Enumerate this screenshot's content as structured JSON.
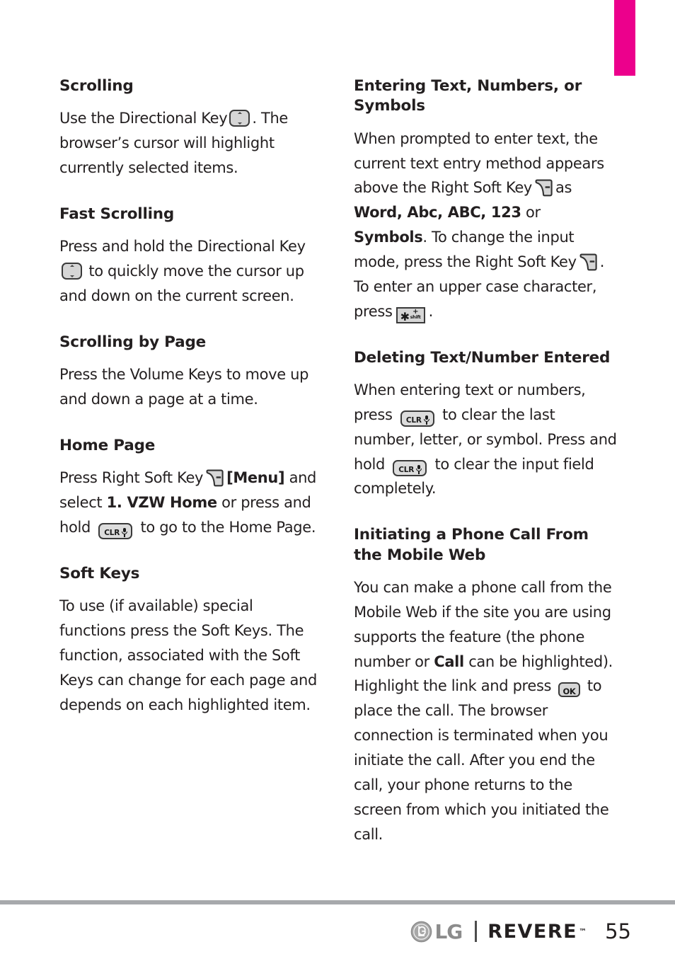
{
  "page": {
    "number": "55",
    "accent_color": "#ec008c",
    "rule_color": "#a7a9ac",
    "text_color": "#231f20"
  },
  "left_column": {
    "sections": [
      {
        "heading": "Scrolling",
        "paragraph": {
          "part1": "Use the Directional Key",
          "icon": "directional-key-icon",
          "part2": ". The browser’s cursor will highlight currently selected items."
        }
      },
      {
        "heading": "Fast Scrolling",
        "paragraph": {
          "part1": "Press and hold the Directional Key",
          "icon": "directional-key-icon",
          "part2": "to quickly move the cursor up and down on the current screen."
        }
      },
      {
        "heading": "Scrolling by Page",
        "paragraph": {
          "part1": "Press the Volume Keys to move up and down a page at a time."
        }
      },
      {
        "heading": "Home Page",
        "paragraph": {
          "part1": "Press Right Soft Key",
          "icon1": "right-soft-key-icon",
          "part2": "[Menu]",
          "part3": "and select",
          "part4": "1. VZW Home",
          "part5": "or press and hold",
          "icon2": "clr-key-icon",
          "part6": "to go to the Home Page."
        }
      },
      {
        "heading": "Soft Keys",
        "paragraph": {
          "part1": "To use (if available) special functions press the Soft Keys. The function, associated with the Soft Keys can change for each page and depends on each highlighted item."
        }
      }
    ]
  },
  "right_column": {
    "sections": [
      {
        "heading": "Entering Text, Numbers, or Symbols",
        "paragraph": {
          "part1": "When prompted to enter text, the current text entry method appears above the Right Soft Key",
          "icon1": "right-soft-key-icon",
          "part2": "as",
          "part3": "Word, Abc, ABC, 123",
          "part4": "or",
          "part5": "Symbols",
          "part6": ". To change the input mode, press the Right Soft Key",
          "icon2": "right-soft-key-icon",
          "part7": ". To enter an upper case character, press",
          "icon3": "shift-key-icon",
          "part8": "."
        }
      },
      {
        "heading": "Deleting Text/Number Entered",
        "paragraph": {
          "part1": "When entering text or numbers, press",
          "icon1": "clr-key-icon",
          "part2": "to clear the last number, letter, or symbol. Press and hold",
          "icon2": "clr-key-icon",
          "part3": "to clear the input field completely."
        }
      },
      {
        "heading": "Initiating a Phone Call From the Mobile Web",
        "paragraph": {
          "part1": "You can make a phone call from the Mobile Web if the site you are using supports the feature (the phone number or",
          "part2": "Call",
          "part3": "can be highlighted). Highlight the link and press",
          "icon1": "ok-key-icon",
          "part4": "to place the call. The browser connection is terminated when you initiate the call. After you end the call, your phone returns to the screen from which you initiated the call."
        }
      }
    ]
  },
  "footer": {
    "brand": "LG",
    "product": "REVERE",
    "trademark": "™",
    "page_number": "55"
  },
  "icons": {
    "clr_label": "CLR",
    "ok_label": "OK",
    "shift_star": "✱",
    "shift_plus": "+",
    "shift_label": "shift"
  }
}
